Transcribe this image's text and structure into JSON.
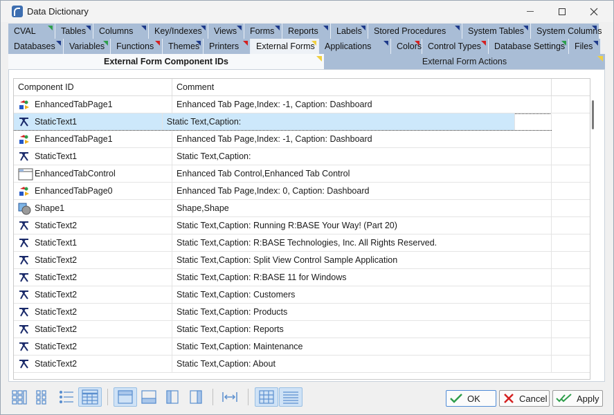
{
  "window": {
    "title": "Data Dictionary"
  },
  "tabs_row1": [
    {
      "label": "CVAL",
      "mark": "green"
    },
    {
      "label": "Tables",
      "mark": "blue"
    },
    {
      "label": "Columns",
      "mark": "blue"
    },
    {
      "label": "Key/Indexes",
      "mark": "blue"
    },
    {
      "label": "Views",
      "mark": "blue"
    },
    {
      "label": "Forms",
      "mark": "blue"
    },
    {
      "label": "Reports",
      "mark": "blue"
    },
    {
      "label": "Labels",
      "mark": "blue"
    },
    {
      "label": "Stored Procedures",
      "mark": "blue"
    },
    {
      "label": "System Tables",
      "mark": "blue"
    },
    {
      "label": "System Columns",
      "mark": "blue"
    }
  ],
  "tabs_row2": [
    {
      "label": "Databases",
      "mark": "blue"
    },
    {
      "label": "Variables",
      "mark": "green"
    },
    {
      "label": "Functions",
      "mark": "red"
    },
    {
      "label": "Themes",
      "mark": "blue"
    },
    {
      "label": "Printers",
      "mark": "red"
    },
    {
      "label": "External Forms",
      "mark": "yellow",
      "active": true
    },
    {
      "label": "Applications",
      "mark": "blue"
    },
    {
      "label": "Colors",
      "mark": "red"
    },
    {
      "label": "Control Types",
      "mark": "red"
    },
    {
      "label": "Database Settings",
      "mark": "green"
    },
    {
      "label": "Files",
      "mark": "blue"
    }
  ],
  "subtabs": {
    "active": "External Form Component IDs",
    "inactive": "External Form Actions"
  },
  "grid": {
    "columns": [
      "Component ID",
      "Comment"
    ],
    "rows": [
      {
        "id": "EnhancedTabPage1",
        "comment": "Enhanced Tab Page,Index: -1, Caption: Dashboard",
        "icon": "tabpage"
      },
      {
        "id": "StaticText1",
        "comment": "Static Text,Caption:",
        "icon": "statictext",
        "selected": true
      },
      {
        "id": "EnhancedTabPage1",
        "comment": "Enhanced Tab Page,Index: -1, Caption: Dashboard",
        "icon": "tabpage"
      },
      {
        "id": "StaticText1",
        "comment": "Static Text,Caption:",
        "icon": "statictext"
      },
      {
        "id": "EnhancedTabControl",
        "comment": "Enhanced Tab Control,Enhanced Tab Control",
        "icon": "tabcontrol"
      },
      {
        "id": "EnhancedTabPage0",
        "comment": "Enhanced Tab Page,Index: 0, Caption: Dashboard",
        "icon": "tabpage"
      },
      {
        "id": "Shape1",
        "comment": "Shape,Shape",
        "icon": "shape"
      },
      {
        "id": "StaticText2",
        "comment": "Static Text,Caption: Running R:BASE Your Way! (Part 20)",
        "icon": "statictext"
      },
      {
        "id": "StaticText1",
        "comment": "Static Text,Caption: R:BASE Technologies, Inc. All Rights Reserved.",
        "icon": "statictext"
      },
      {
        "id": "StaticText2",
        "comment": "Static Text,Caption: Split View Control Sample Application",
        "icon": "statictext"
      },
      {
        "id": "StaticText2",
        "comment": "Static Text,Caption: R:BASE 11 for Windows",
        "icon": "statictext"
      },
      {
        "id": "StaticText2",
        "comment": "Static Text,Caption: Customers",
        "icon": "statictext"
      },
      {
        "id": "StaticText2",
        "comment": "Static Text,Caption: Products",
        "icon": "statictext"
      },
      {
        "id": "StaticText2",
        "comment": "Static Text,Caption: Reports",
        "icon": "statictext"
      },
      {
        "id": "StaticText2",
        "comment": "Static Text,Caption: Maintenance",
        "icon": "statictext"
      },
      {
        "id": "StaticText2",
        "comment": "Static Text,Caption: About",
        "icon": "statictext"
      }
    ]
  },
  "buttons": {
    "ok": "OK",
    "cancel": "Cancel",
    "apply": "Apply"
  }
}
